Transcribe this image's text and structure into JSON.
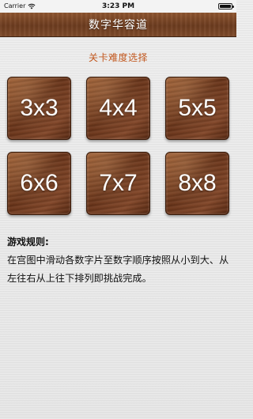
{
  "status_bar": {
    "carrier": "Carrier",
    "time": "3:23 PM",
    "wifi_icon": "wifi-icon",
    "battery_icon": "battery-icon",
    "battery_level": 1.0
  },
  "nav": {
    "title": "数字华容道"
  },
  "levels": {
    "section_title": "关卡难度选择",
    "items": [
      {
        "label": "3x3"
      },
      {
        "label": "4x4"
      },
      {
        "label": "5x5"
      },
      {
        "label": "6x6"
      },
      {
        "label": "7x7"
      },
      {
        "label": "8x8"
      }
    ]
  },
  "rules": {
    "title": "游戏规则:",
    "text": "在宫图中滑动各数字片至数字顺序按照从小到大、从左往右从上往下排列即挑战完成。"
  },
  "colors": {
    "accent": "#c2581f",
    "wood_dark": "#6a351a",
    "wood_light": "#9a5a30",
    "nav_bar": "#7e4a2a"
  }
}
